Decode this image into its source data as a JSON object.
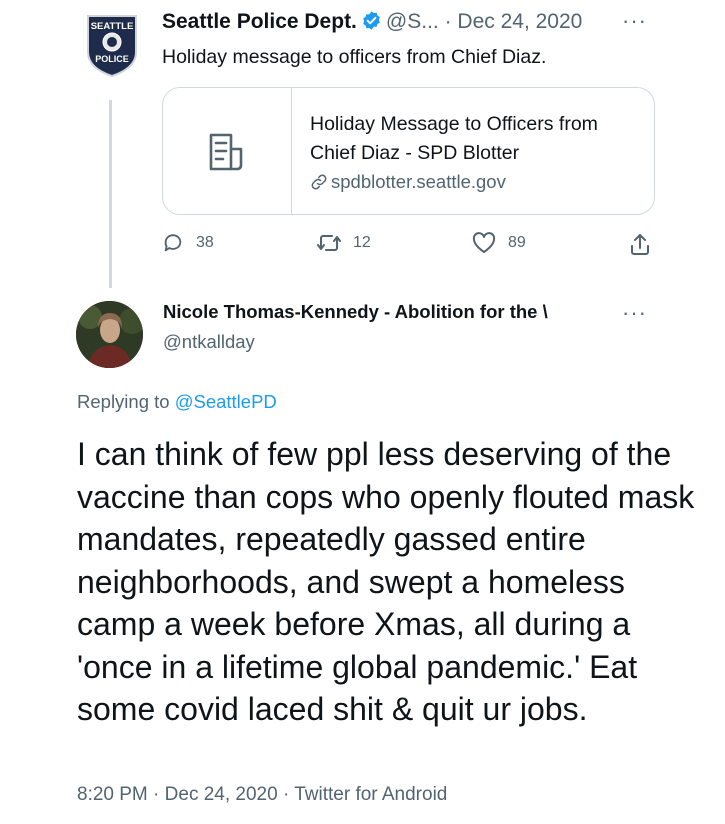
{
  "original_tweet": {
    "badge_text_top": "SEATTLE",
    "badge_text_bottom": "POLICE",
    "display_name": "Seattle Police Dept.",
    "handle": "@S...",
    "separator": "·",
    "date": "Dec 24, 2020",
    "text": "Holiday message to officers from Chief Diaz.",
    "card": {
      "icon": "document-icon",
      "title": "Holiday Message to Officers from Chief Diaz - SPD Blotter",
      "domain": "spdblotter.seattle.gov"
    },
    "actions": {
      "replies": "38",
      "retweets": "12",
      "likes": "89"
    }
  },
  "reply_tweet": {
    "display_name": "Nicole Thomas-Kennedy - Abolition for the \\",
    "handle": "@ntkallday",
    "replying_prefix": "Replying to",
    "replying_to": "@SeattlePD",
    "text": "I can think of few ppl less deserving of the vaccine than cops who openly flouted mask mandates, repeatedly gassed entire neighborhoods, and swept a homeless camp a week before Xmas, all during a 'once in a lifetime global pandemic.' Eat some covid laced shit & quit ur jobs.",
    "time": "8:20 PM",
    "date": "Dec 24, 2020",
    "separator": "·",
    "source": "Twitter for Android"
  },
  "more_label": "···",
  "colors": {
    "text": "#0f1419",
    "muted": "#536471",
    "link": "#1d9bf0",
    "border": "#cfd9de",
    "badge": "#1e2b4a"
  }
}
